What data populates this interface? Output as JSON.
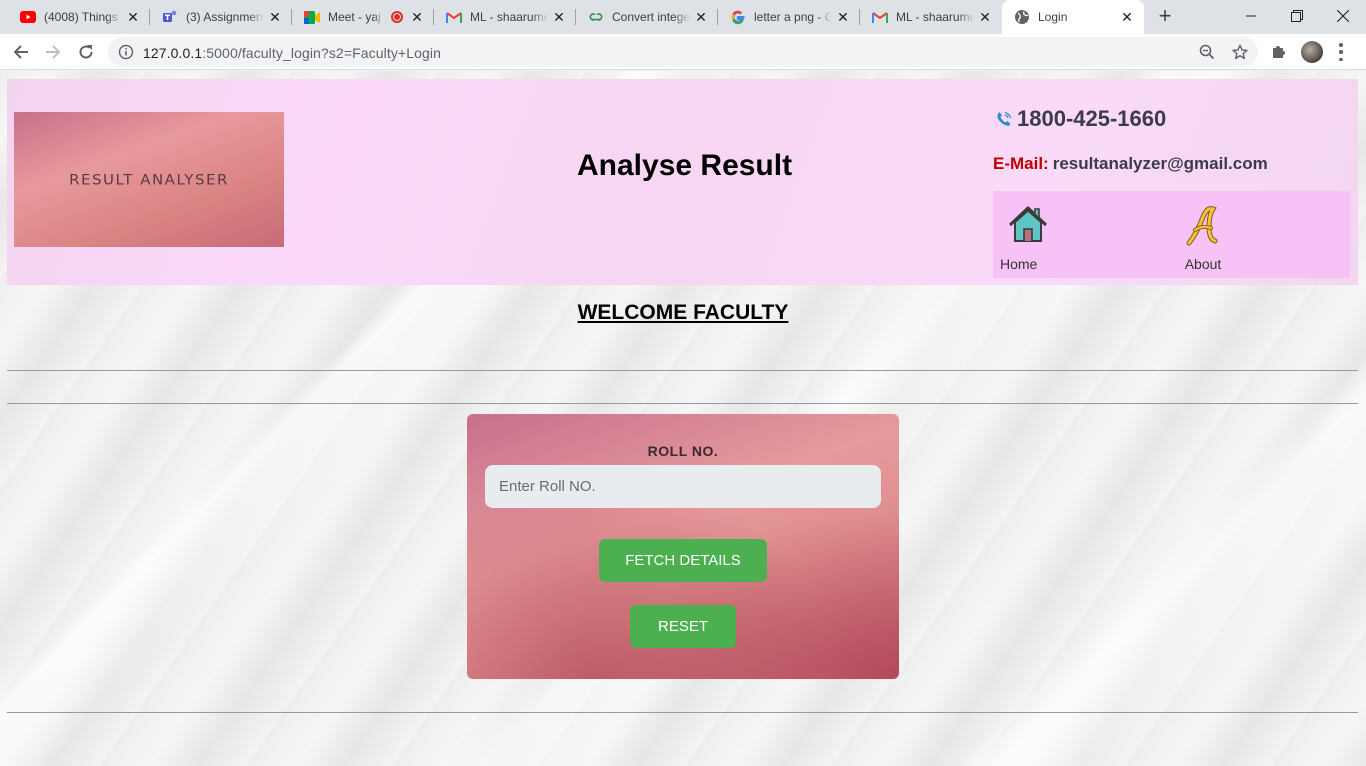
{
  "browser": {
    "tabs": [
      {
        "title": "(4008) Things w",
        "icon": "youtube-icon"
      },
      {
        "title": "(3) Assignment",
        "icon": "teams-icon"
      },
      {
        "title": "Meet - yaj",
        "icon": "meet-icon"
      },
      {
        "title": "ML - shaarume",
        "icon": "gmail-icon"
      },
      {
        "title": "Convert intege",
        "icon": "geeksforgeeks-icon"
      },
      {
        "title": "letter a png - G",
        "icon": "google-icon"
      },
      {
        "title": "ML - shaarume",
        "icon": "gmail-icon"
      },
      {
        "title": "Login",
        "icon": "globe-icon"
      }
    ],
    "active_tab": 7,
    "url_host": "127.0.0.1",
    "url_rest": ":5000/faculty_login?s2=Faculty+Login"
  },
  "header": {
    "logo_text": "RESULT ANALYSER",
    "site_title": "Analyse Result",
    "phone": "1800-425-1660",
    "email_label": "E-Mail:",
    "email": "resultanalyzer@gmail.com",
    "nav": [
      {
        "label": "Home",
        "icon": "home-icon"
      },
      {
        "label": "About",
        "icon": "letter-a-icon"
      }
    ]
  },
  "main": {
    "welcome": "WELCOME FACULTY",
    "form": {
      "label": "ROLL NO.",
      "input_placeholder": "Enter Roll NO.",
      "input_value": "",
      "fetch_label": "FETCH DETAILS",
      "reset_label": "RESET"
    }
  },
  "colors": {
    "button_green": "#4caf50",
    "email_label_red": "#c00000",
    "nav_box_pink": "#f7c2f5"
  }
}
